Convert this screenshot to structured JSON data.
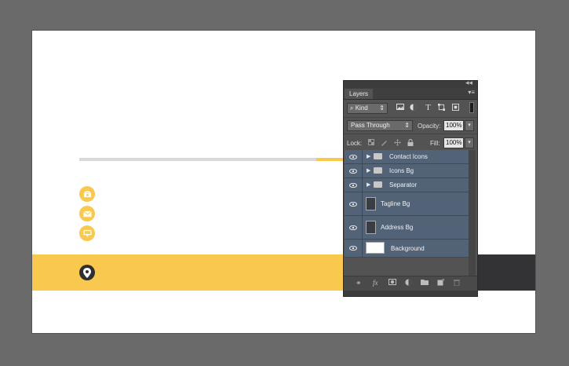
{
  "panel": {
    "title": "Layers",
    "collapse_glyph": "◂◂",
    "close_glyph": "×",
    "menu_glyph": "▾≡",
    "filter": {
      "kind_label": "Kind",
      "search_glyph": "⌕",
      "arrows": "⇕"
    },
    "filter_icons": [
      "image-icon",
      "adjustment-icon",
      "type-icon",
      "shape-icon",
      "smart-object-icon"
    ],
    "blend_mode": "Pass Through",
    "opacity_label": "Opacity:",
    "opacity_value": "100%",
    "lock_label": "Lock:",
    "fill_label": "Fill:",
    "fill_value": "100%",
    "dropdown_arrow": "▾",
    "layers": [
      {
        "name": "Contact Icons",
        "type": "group",
        "visible": true
      },
      {
        "name": "Icons Bg",
        "type": "group",
        "visible": true
      },
      {
        "name": "Separator",
        "type": "group",
        "visible": true
      },
      {
        "name": "Tagline Bg",
        "type": "shape",
        "visible": true
      },
      {
        "name": "Address Bg",
        "type": "shape",
        "visible": true
      },
      {
        "name": "Background",
        "type": "fill",
        "visible": true
      }
    ],
    "bottom_icons": [
      "link-layers-icon",
      "fx-icon",
      "add-mask-icon",
      "new-adjustment-icon",
      "new-group-icon",
      "new-layer-icon",
      "delete-layer-icon"
    ]
  },
  "canvas": {
    "accent_color": "#f9c94f",
    "dark_color": "#333335",
    "separator_color": "#d9d9d9",
    "contact_icons": [
      "phone-icon",
      "mail-icon",
      "chat-icon"
    ],
    "location_icon": "map-pin-icon"
  }
}
